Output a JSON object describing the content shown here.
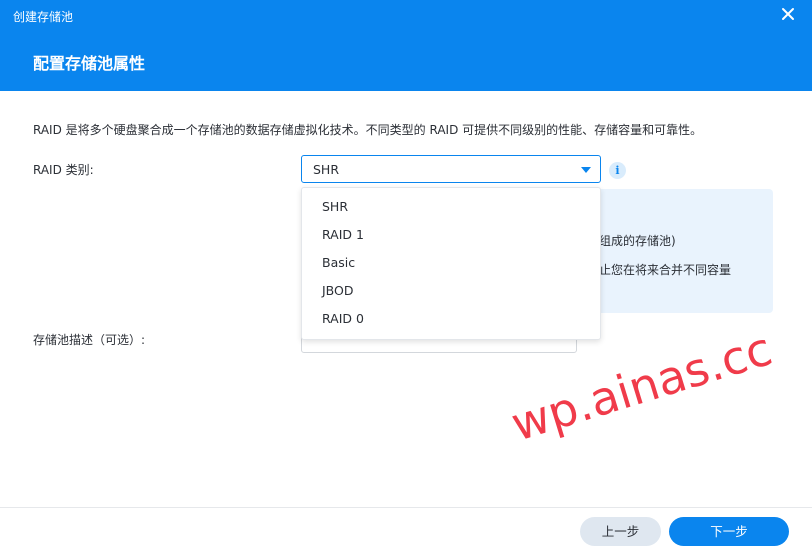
{
  "window": {
    "title": "创建存储池",
    "close_icon": "close-icon"
  },
  "page": {
    "title": "配置存储池属性"
  },
  "description": "RAID 是将多个硬盘聚合成一个存储池的数据存储虚拟化技术。不同类型的 RAID 可提供不同级别的性能、存储容量和可靠性。",
  "raid_field": {
    "label": "RAID 类别:",
    "selected": "SHR",
    "info_icon": "i",
    "options": [
      "SHR",
      "RAID 1",
      "Basic",
      "JBOD",
      "RAID 0"
    ]
  },
  "info_panel": {
    "line1": "组成的存储池)",
    "line2": "止您在将来合并不同容量"
  },
  "desc_field": {
    "label": "存储池描述（可选）:",
    "value": ""
  },
  "footer": {
    "prev_label": "上一步",
    "next_label": "下一步"
  },
  "watermark": "wp.ainas.cc",
  "colors": {
    "accent": "#0a85ee",
    "panel": "#e9f3fd",
    "watermark": "#f03b4a"
  }
}
